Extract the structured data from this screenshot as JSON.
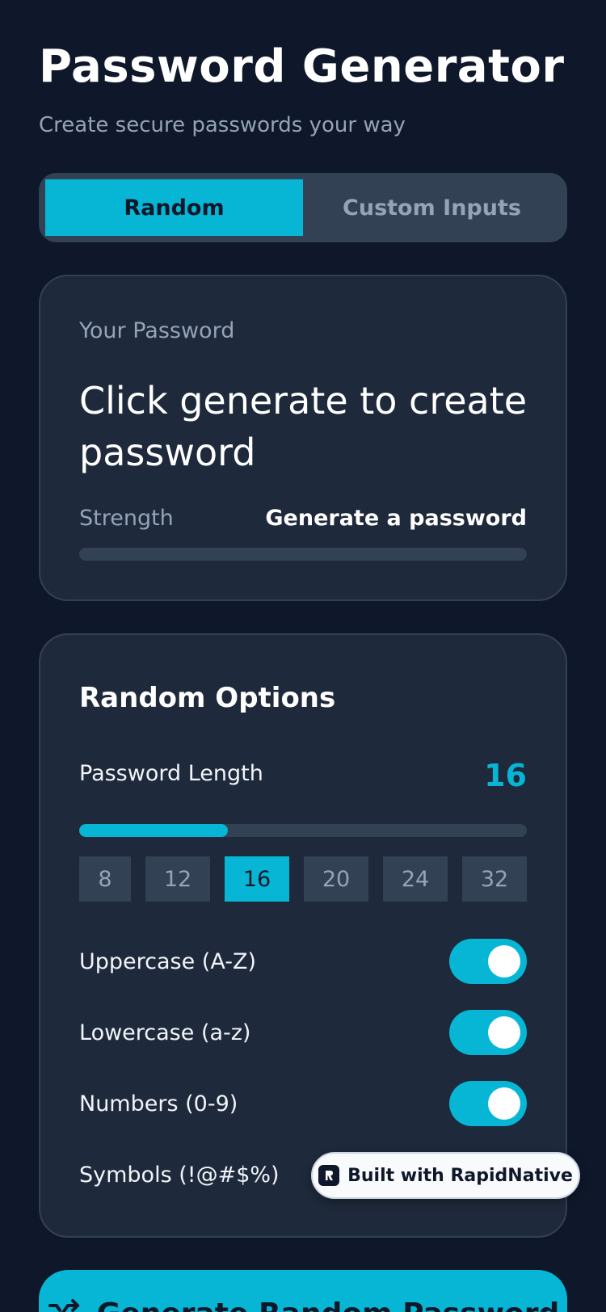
{
  "header": {
    "title": "Password Generator",
    "subtitle": "Create secure passwords your way"
  },
  "tabs": [
    {
      "label": "Random",
      "active": true
    },
    {
      "label": "Custom Inputs",
      "active": false
    }
  ],
  "password_card": {
    "label": "Your Password",
    "value": "Click generate to create password",
    "strength_label": "Strength",
    "strength_value": "Generate a password",
    "strength_level": 0
  },
  "options": {
    "title": "Random Options",
    "length_label": "Password Length",
    "length_value": "16",
    "length_fraction": 0.333,
    "presets": [
      "8",
      "12",
      "16",
      "20",
      "24",
      "32"
    ],
    "selected_preset": "16",
    "toggles": [
      {
        "label": "Uppercase (A-Z)",
        "on": true
      },
      {
        "label": "Lowercase (a-z)",
        "on": true
      },
      {
        "label": "Numbers (0-9)",
        "on": true
      },
      {
        "label": "Symbols (!@#$%)",
        "on": true
      }
    ]
  },
  "badge": {
    "label": "Built with RapidNative",
    "icon": "rapidnative-logo-icon"
  },
  "generate_button": {
    "label": "Generate Random Password",
    "icon": "shuffle-icon"
  },
  "colors": {
    "background": "#0f172a",
    "card": "#1e293b",
    "accent": "#06b6d4",
    "muted": "#94a3b8",
    "track": "#334155"
  }
}
